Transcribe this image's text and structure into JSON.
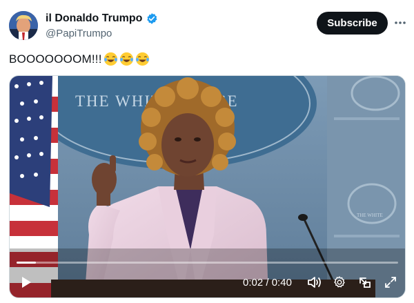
{
  "post": {
    "display_name": "il Donaldo Trumpo",
    "handle": "@PapiTrumpo",
    "text": "BOOOOOOOM!!!",
    "emojis": [
      "face-with-tears-of-joy",
      "face-with-tears-of-joy",
      "face-with-tears-of-joy"
    ]
  },
  "actions": {
    "subscribe_label": "Subscribe",
    "more_label": "···"
  },
  "video": {
    "current_time": "0:02",
    "separator": "/",
    "duration": "0:40",
    "progress_fraction": 0.05,
    "backdrop_text": "THE WHITE HOUSE",
    "seal_text": "THE WHITE"
  },
  "colors": {
    "accent": "#1d9bf0",
    "subscribe_bg": "#0f1419",
    "text_primary": "#0f1419",
    "text_secondary": "#536471"
  },
  "icons": {
    "verified": "verified-badge-icon",
    "more": "more-options-icon",
    "play": "play-icon",
    "volume": "volume-icon",
    "settings": "gear-icon",
    "pip": "picture-in-picture-icon",
    "fullscreen": "fullscreen-icon"
  }
}
